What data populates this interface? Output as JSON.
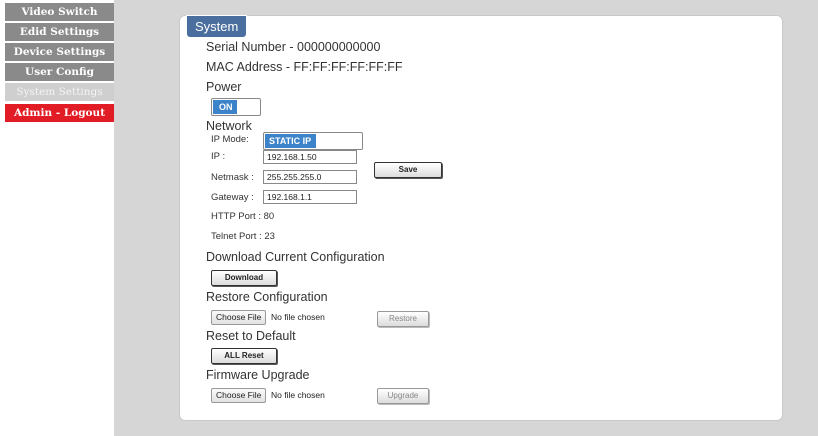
{
  "sidebar": {
    "items": [
      {
        "label": "Video Switch"
      },
      {
        "label": "Edid Settings"
      },
      {
        "label": "Device Settings"
      },
      {
        "label": "User Config"
      },
      {
        "label": "System Settings"
      },
      {
        "label": "Admin - Logout"
      }
    ]
  },
  "colors": {
    "accent": "#4a6e9e",
    "toggle_on": "#3d83c9",
    "logout": "#e11c24",
    "nav": "#8a8a8a"
  },
  "panel": {
    "title": "System",
    "serial_label": "Serial Number - ",
    "serial_value": "000000000000",
    "mac_label": "MAC Address - ",
    "mac_value": "FF:FF:FF:FF:FF:FF",
    "power": {
      "label": "Power",
      "state": "ON"
    },
    "network": {
      "label": "Network",
      "ip_mode_label": "IP Mode:",
      "ip_mode_value": "STATIC IP",
      "ip_label": "IP :",
      "ip_value": "192.168.1.50",
      "netmask_label": "Netmask :",
      "netmask_value": "255.255.255.0",
      "gateway_label": "Gateway :",
      "gateway_value": "192.168.1.1",
      "http_port": "HTTP Port : 80",
      "telnet_port": "Telnet Port : 23",
      "save_label": "Save"
    },
    "download": {
      "label": "Download Current Configuration",
      "button": "Download"
    },
    "restore": {
      "label": "Restore Configuration",
      "choose": "Choose File",
      "nofile": "No file chosen",
      "button": "Restore"
    },
    "reset": {
      "label": "Reset to Default",
      "button": "ALL Reset"
    },
    "firmware": {
      "label": "Firmware Upgrade",
      "choose": "Choose File",
      "nofile": "No file chosen",
      "button": "Upgrade"
    }
  }
}
